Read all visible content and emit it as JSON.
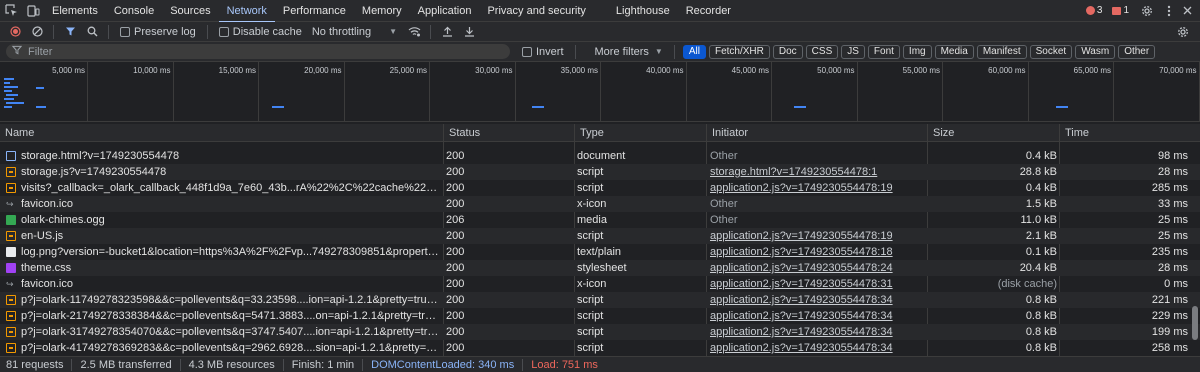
{
  "tabbar": {
    "tabs": [
      {
        "label": "Elements"
      },
      {
        "label": "Console"
      },
      {
        "label": "Sources"
      },
      {
        "label": "Network",
        "active": true
      },
      {
        "label": "Performance"
      },
      {
        "label": "Memory"
      },
      {
        "label": "Application"
      },
      {
        "label": "Privacy and security"
      },
      {
        "label": "Lighthouse"
      },
      {
        "label": "Recorder"
      }
    ],
    "error_count": "3",
    "issue_count": "1"
  },
  "toolbar": {
    "preserve_log": "Preserve log",
    "disable_cache": "Disable cache",
    "throttling": "No throttling"
  },
  "filterbar": {
    "placeholder": "Filter",
    "invert": "Invert",
    "more_filters": "More filters",
    "types": [
      "All",
      "Fetch/XHR",
      "Doc",
      "CSS",
      "JS",
      "Font",
      "Img",
      "Media",
      "Manifest",
      "Socket",
      "Wasm",
      "Other"
    ],
    "active_type": "All"
  },
  "overview": {
    "ticks": [
      "5,000 ms",
      "10,000 ms",
      "15,000 ms",
      "20,000 ms",
      "25,000 ms",
      "30,000 ms",
      "35,000 ms",
      "40,000 ms",
      "45,000 ms",
      "50,000 ms",
      "55,000 ms",
      "60,000 ms",
      "65,000 ms",
      "70,000 ms"
    ]
  },
  "table": {
    "columns": {
      "name": "Name",
      "status": "Status",
      "type": "Type",
      "initiator": "Initiator",
      "size": "Size",
      "time": "Time"
    },
    "rows": [
      {
        "icon": "doc",
        "name": "storage.html?v=1749230554478",
        "status": "200",
        "type": "document",
        "initiator": "Other",
        "initiator_kind": "other",
        "size": "0.4 kB",
        "time": "98 ms"
      },
      {
        "icon": "js",
        "name": "storage.js?v=1749230554478",
        "status": "200",
        "type": "script",
        "initiator": "storage.html?v=1749230554478:1",
        "initiator_kind": "link",
        "size": "28.8 kB",
        "time": "28 ms"
      },
      {
        "icon": "js",
        "name": "visits?_callback=_olark_callback_448f1d9a_7e60_43b...rA%22%2C%22cache%22%3A%220.8308492091...",
        "status": "200",
        "type": "script",
        "initiator": "application2.js?v=1749230554478:19",
        "initiator_kind": "link",
        "size": "0.4 kB",
        "time": "285 ms"
      },
      {
        "icon": "fav",
        "name": "favicon.ico",
        "status": "200",
        "type": "x-icon",
        "initiator": "Other",
        "initiator_kind": "other",
        "size": "1.5 kB",
        "time": "33 ms"
      },
      {
        "icon": "media",
        "name": "olark-chimes.ogg",
        "status": "206",
        "type": "media",
        "initiator": "Other",
        "initiator_kind": "other",
        "size": "11.0 kB",
        "time": "25 ms"
      },
      {
        "icon": "js",
        "name": "en-US.js",
        "status": "200",
        "type": "script",
        "initiator": "application2.js?v=1749230554478:19",
        "initiator_kind": "link",
        "size": "2.1 kB",
        "time": "25 ms"
      },
      {
        "icon": "text",
        "name": "log.png?version=-bucket1&location=https%3A%2F%2Fvp...749278309851&properties=%7B%7D&rec...",
        "status": "200",
        "type": "text/plain",
        "initiator": "application2.js?v=1749230554478:18",
        "initiator_kind": "link",
        "size": "0.1 kB",
        "time": "235 ms"
      },
      {
        "icon": "css",
        "name": "theme.css",
        "status": "200",
        "type": "stylesheet",
        "initiator": "application2.js?v=1749230554478:24",
        "initiator_kind": "link",
        "size": "20.4 kB",
        "time": "28 ms"
      },
      {
        "icon": "fav",
        "name": "favicon.ico",
        "status": "200",
        "type": "x-icon",
        "initiator": "application2.js?v=1749230554478:31",
        "initiator_kind": "link",
        "size": "(disk cache)",
        "time": "0 ms"
      },
      {
        "icon": "js",
        "name": "p?j=olark-11749278323598&&c=pollevents&q=33.23598....ion=api-1.2.1&pretty=true&_rnd=0.44494...",
        "status": "200",
        "type": "script",
        "initiator": "application2.js?v=1749230554478:34",
        "initiator_kind": "link",
        "size": "0.8 kB",
        "time": "221 ms"
      },
      {
        "icon": "js",
        "name": "p?j=olark-21749278338384&&c=pollevents&q=5471.3883....on=api-1.2.1&pretty=true&_rnd=0.1076...",
        "status": "200",
        "type": "script",
        "initiator": "application2.js?v=1749230554478:34",
        "initiator_kind": "link",
        "size": "0.8 kB",
        "time": "229 ms"
      },
      {
        "icon": "js",
        "name": "p?j=olark-31749278354070&&c=pollevents&q=3747.5407....ion=api-1.2.1&pretty=true&_rnd=0.7411...",
        "status": "200",
        "type": "script",
        "initiator": "application2.js?v=1749230554478:34",
        "initiator_kind": "link",
        "size": "0.8 kB",
        "time": "199 ms"
      },
      {
        "icon": "js",
        "name": "p?j=olark-41749278369283&&c=pollevents&q=2962.6928....sion=api-1.2.1&pretty=true&_rnd=0.699...",
        "status": "200",
        "type": "script",
        "initiator": "application2.js?v=1749230554478:34",
        "initiator_kind": "link",
        "size": "0.8 kB",
        "time": "258 ms"
      }
    ]
  },
  "statusbar": {
    "requests": "81 requests",
    "transferred": "2.5 MB transferred",
    "resources": "4.3 MB resources",
    "finish": "Finish: 1 min",
    "dom_content_loaded": "DOMContentLoaded: 340 ms",
    "load": "Load: 751 ms"
  }
}
